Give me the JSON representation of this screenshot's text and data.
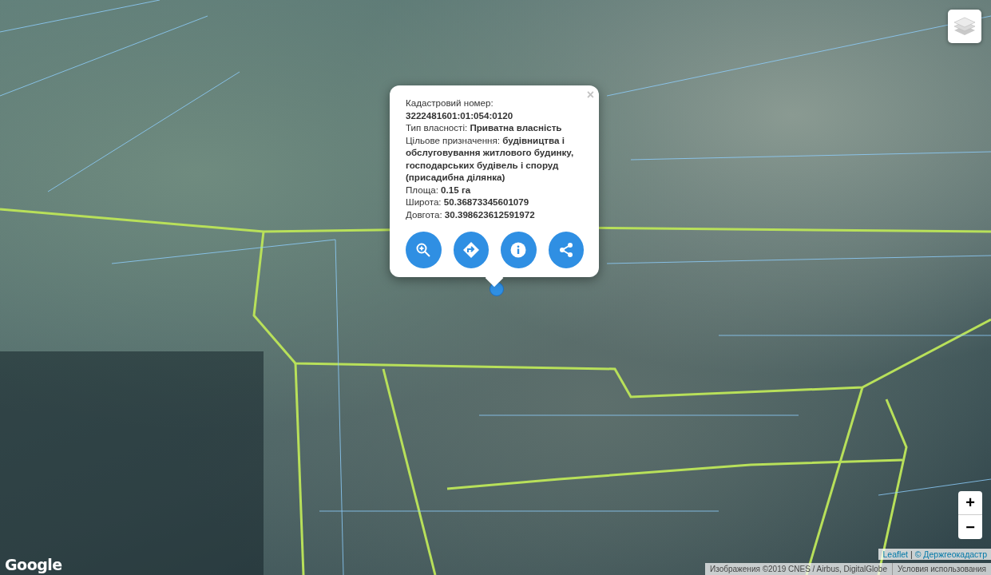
{
  "popup": {
    "close": "×",
    "lines": [
      {
        "text": "Кадастровий номер:",
        "kind": "field"
      },
      {
        "text": "3222481601:01:054:0120",
        "kind": "value"
      },
      {
        "text": "Тип власності: **Приватна власність**",
        "kind": "field"
      },
      {
        "text": "Цільове призначення: **будівництва і обслуговування житлового будинку, господарських будівель і споруд (присадибна ділянка)**",
        "kind": "field"
      },
      {
        "text": "Площа: **0.15 га**",
        "kind": "field"
      },
      {
        "text": "Широта: **50.36873345601079**",
        "kind": "field"
      },
      {
        "text": "Довгота: **30.398623612591972**",
        "kind": "field"
      }
    ],
    "buttons": [
      {
        "kind": "zoom"
      },
      {
        "kind": "route"
      },
      {
        "kind": "info"
      },
      {
        "kind": "share"
      }
    ]
  },
  "zoom_controls": {
    "zoom_in": "+",
    "zoom_out": "−"
  },
  "attribution": {
    "leaflet": "Leaflet",
    "separator": "|",
    "source": "© Держгеокадастр"
  },
  "google": {
    "logo": "Google",
    "imagery": "Изображения ©2019 CNES / Airbus, DigitalGlobe",
    "terms": "Условия использования"
  }
}
